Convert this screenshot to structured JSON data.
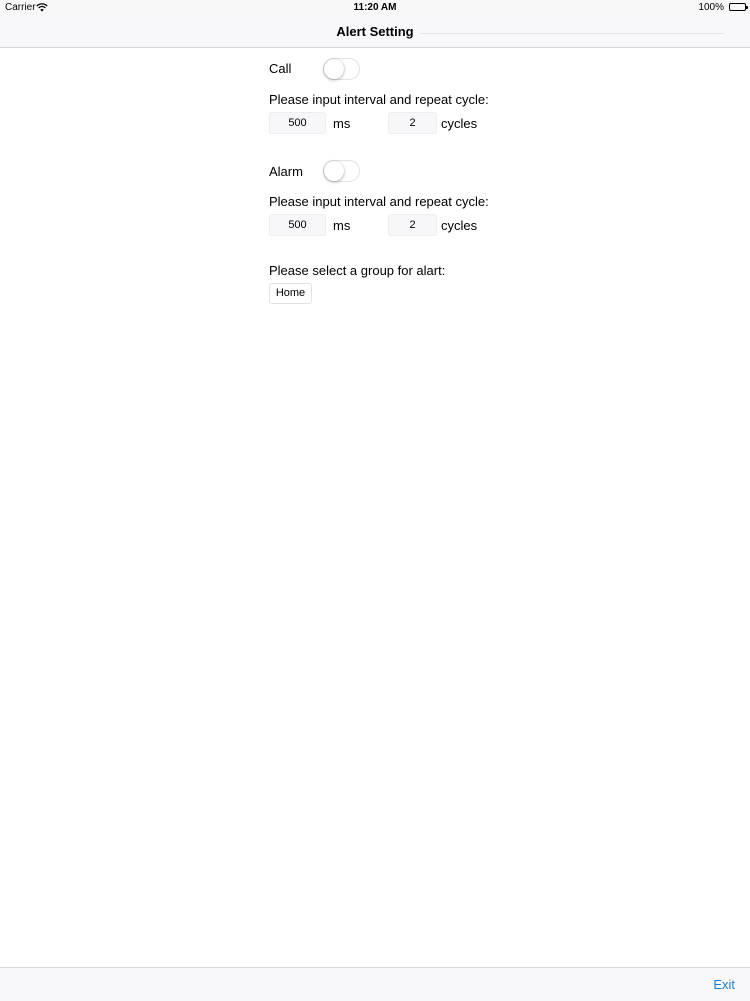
{
  "status_bar": {
    "carrier": "Carrier",
    "time": "11:20 AM",
    "battery": "100%"
  },
  "nav": {
    "title": "Alert Setting"
  },
  "call": {
    "label": "Call",
    "toggle_on": false,
    "prompt": "Please input interval and repeat cycle:",
    "interval_value": "500",
    "interval_unit": "ms",
    "cycles_value": "2",
    "cycles_unit": "cycles"
  },
  "alarm": {
    "label": "Alarm",
    "toggle_on": false,
    "prompt": "Please input interval and repeat cycle:",
    "interval_value": "500",
    "interval_unit": "ms",
    "cycles_value": "2",
    "cycles_unit": "cycles"
  },
  "group": {
    "prompt": "Please select a group for alart:",
    "selected": "Home"
  },
  "toolbar": {
    "exit_label": "Exit"
  },
  "colors": {
    "accent": "#1b7dd7",
    "bar_background": "#f8f7fa"
  },
  "icons": {
    "wifi": "wifi-icon",
    "battery": "battery-icon"
  }
}
